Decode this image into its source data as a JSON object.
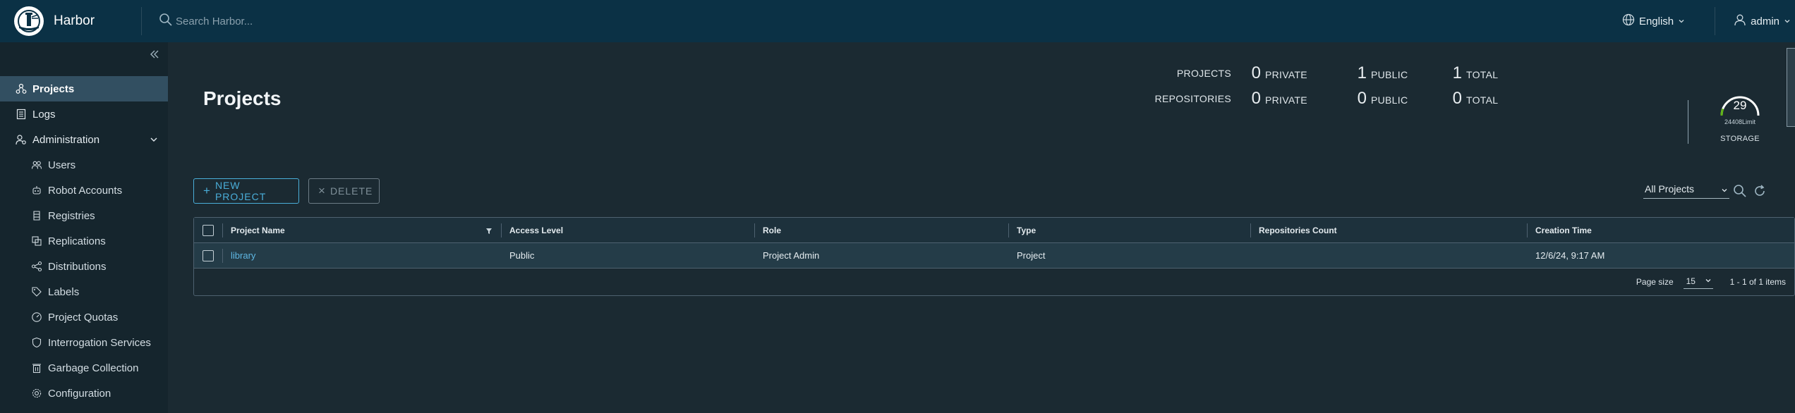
{
  "header": {
    "brand": "Harbor",
    "search_placeholder": "Search Harbor...",
    "language": "English",
    "user": "admin"
  },
  "sidebar": {
    "items": [
      {
        "label": "Projects",
        "icon": "projects-icon"
      },
      {
        "label": "Logs",
        "icon": "logs-icon"
      },
      {
        "label": "Administration",
        "icon": "administration-icon"
      },
      {
        "label": "Users",
        "icon": "users-icon"
      },
      {
        "label": "Robot Accounts",
        "icon": "robot-icon"
      },
      {
        "label": "Registries",
        "icon": "registries-icon"
      },
      {
        "label": "Replications",
        "icon": "replications-icon"
      },
      {
        "label": "Distributions",
        "icon": "distributions-icon"
      },
      {
        "label": "Labels",
        "icon": "labels-icon"
      },
      {
        "label": "Project Quotas",
        "icon": "quotas-icon"
      },
      {
        "label": "Interrogation Services",
        "icon": "shield-icon"
      },
      {
        "label": "Garbage Collection",
        "icon": "trash-icon"
      },
      {
        "label": "Configuration",
        "icon": "gear-icon"
      }
    ]
  },
  "page": {
    "title": "Projects"
  },
  "stats": {
    "projects_label": "PROJECTS",
    "repositories_label": "REPOSITORIES",
    "private_word": "PRIVATE",
    "public_word": "PUBLIC",
    "total_word": "TOTAL",
    "projects": {
      "private": "0",
      "public": "1",
      "total": "1"
    },
    "repositories": {
      "private": "0",
      "public": "0",
      "total": "0"
    }
  },
  "storage": {
    "value": "29",
    "limit": "24408Limit",
    "label": "STORAGE",
    "fraction": 0.12
  },
  "toolbar": {
    "new_project": "NEW PROJECT",
    "delete": "DELETE",
    "filter_selected": "All Projects"
  },
  "table": {
    "columns": [
      "Project Name",
      "Access Level",
      "Role",
      "Type",
      "Repositories Count",
      "Creation Time"
    ],
    "rows": [
      {
        "name": "library",
        "access": "Public",
        "role": "Project Admin",
        "type": "Project",
        "repo_count": "",
        "created": "12/6/24, 9:17 AM"
      }
    ],
    "footer": {
      "page_size_label": "Page size",
      "page_size": "15",
      "range": "1 - 1 of 1 items"
    }
  },
  "colors": {
    "header_bg": "#0b3145",
    "sidebar_bg": "#15252d",
    "main_bg": "#1b2a32",
    "accent": "#4aaed9",
    "active_nav": "#324f61",
    "gauge_green": "#60b515"
  }
}
